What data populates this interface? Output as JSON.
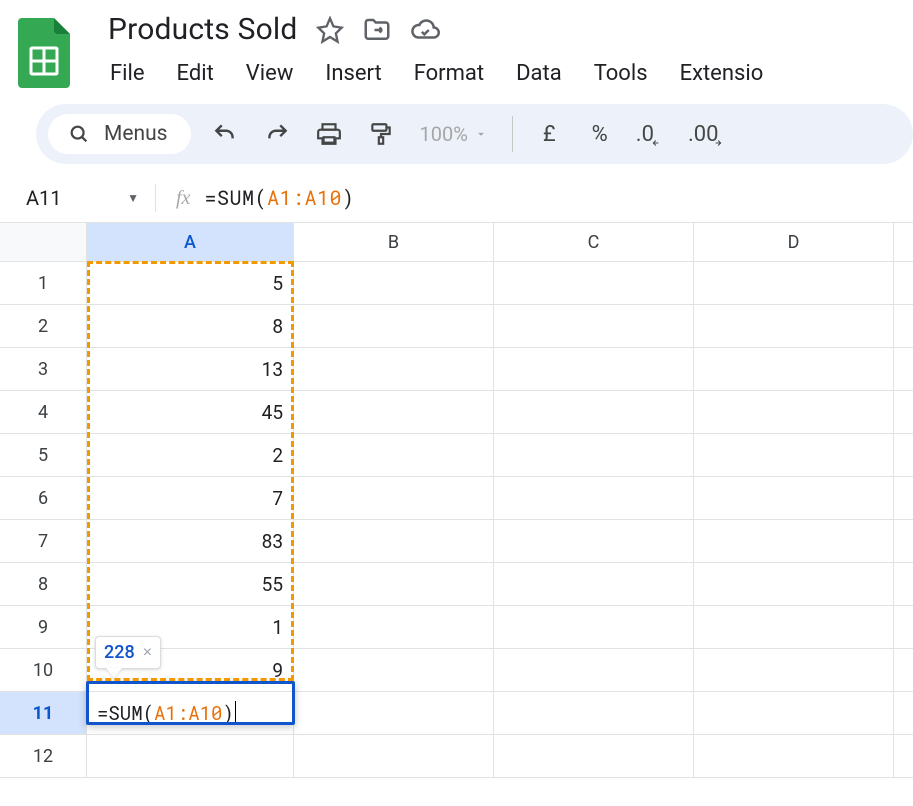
{
  "header": {
    "doc_title": "Products Sold",
    "menus": [
      "File",
      "Edit",
      "View",
      "Insert",
      "Format",
      "Data",
      "Tools",
      "Extensio"
    ]
  },
  "toolbar": {
    "menus_pill": "Menus",
    "zoom": "100%",
    "currency_symbol": "£",
    "percent_symbol": "%",
    "dec_decrease": ".0",
    "dec_increase": ".00"
  },
  "namebox": {
    "ref": "A11"
  },
  "formula": {
    "prefix": "=SUM(",
    "range": "A1:A10",
    "suffix": ")"
  },
  "columns": [
    "A",
    "B",
    "C",
    "D"
  ],
  "row_numbers": [
    "1",
    "2",
    "3",
    "4",
    "5",
    "6",
    "7",
    "8",
    "9",
    "10",
    "11",
    "12"
  ],
  "tooltip": {
    "value": "228"
  },
  "active_cell_display": {
    "prefix": "=SUM(",
    "range": "A1:A10",
    "suffix": ")"
  },
  "chart_data": {
    "type": "table",
    "columns": [
      "A"
    ],
    "rows": [
      {
        "A": 5
      },
      {
        "A": 8
      },
      {
        "A": 13
      },
      {
        "A": 45
      },
      {
        "A": 2
      },
      {
        "A": 7
      },
      {
        "A": 83
      },
      {
        "A": 55
      },
      {
        "A": 1
      },
      {
        "A": 9
      }
    ],
    "formula_cell": {
      "ref": "A11",
      "formula": "=SUM(A1:A10)",
      "preview": 228
    }
  }
}
